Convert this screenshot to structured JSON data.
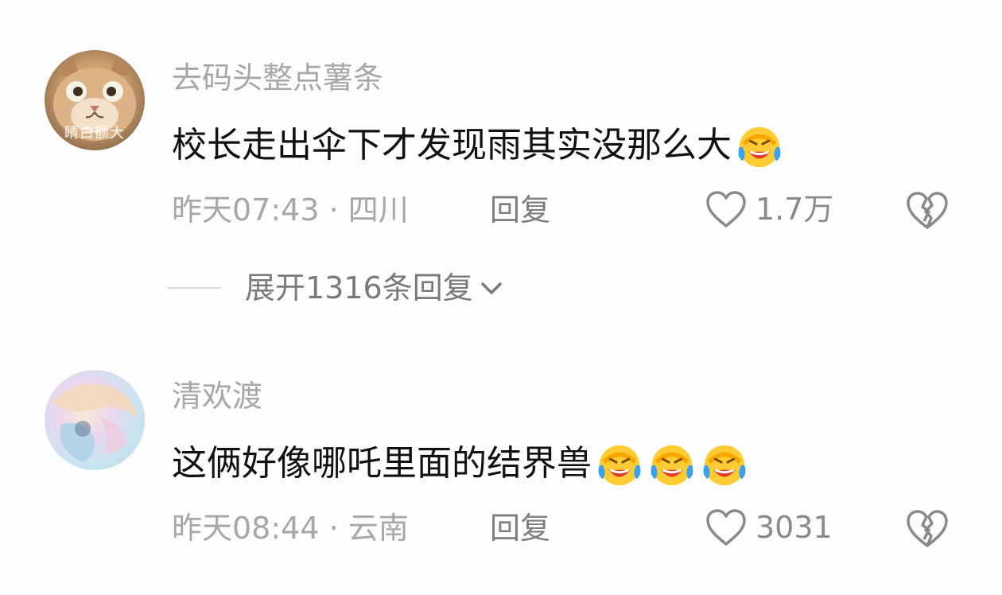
{
  "comments": [
    {
      "username": "去码头整点薯条",
      "avatar_caption": "睛白额大",
      "text": "校长走出伞下才发现雨其实没那么大",
      "emojis": [
        "laugh-cry"
      ],
      "time": "昨天07:43",
      "location": "四川",
      "meta": "昨天07:43 · 四川",
      "reply_label": "回复",
      "likes": "1.7万"
    },
    {
      "username": "清欢渡",
      "text": "这俩好像哪吒里面的结界兽",
      "emojis": [
        "laugh-cry",
        "laugh-cry",
        "laugh-cry"
      ],
      "time": "昨天08:44",
      "location": "云南",
      "meta": "昨天08:44 · 云南",
      "reply_label": "回复",
      "likes": "3031"
    }
  ],
  "expand_replies": {
    "label": "展开1316条回复"
  },
  "icons": {
    "like": "heart-outline-icon",
    "dislike": "broken-heart-icon",
    "expand": "chevron-down-icon",
    "emoji": "laugh-cry-emoji-icon"
  },
  "colors": {
    "background": "#fdfdfd",
    "username": "#a7a7a7",
    "text": "#111111",
    "meta": "#a7a7a7"
  }
}
